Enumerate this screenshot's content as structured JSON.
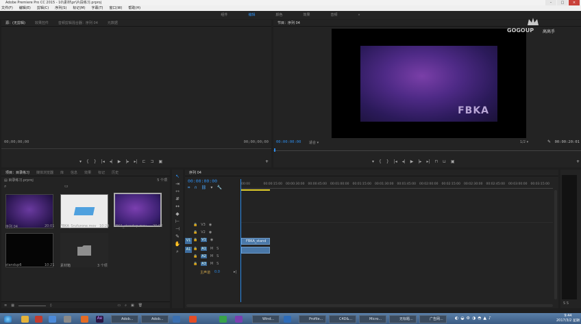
{
  "title_bar": {
    "text": "Adobe Premiere Pro CC 2015 - 10\\素材\\pr\\片段练习.prproj"
  },
  "menu": [
    "文件(F)",
    "编辑(E)",
    "剪辑(C)",
    "序列(S)",
    "标记(M)",
    "字幕(T)",
    "窗口(W)",
    "帮助(H)"
  ],
  "workspaces": {
    "items": [
      "组件",
      "编辑",
      "颜色",
      "效果",
      "音频"
    ],
    "active": 1
  },
  "source_panel": {
    "tabs": [
      "源：(无剪辑)",
      "效果控件",
      "音频剪辑混合器：序列 04",
      "元数据"
    ],
    "timecode_left": "00;00;00;00",
    "timecode_right": "00;00;00;00"
  },
  "program_panel": {
    "tab": "节目：序列 04",
    "timecode": "00:00:00:00",
    "fit": "适合",
    "ratio": "1/2",
    "timecode_end": "00:00:20:01",
    "watermark": "FBKA"
  },
  "logo": {
    "text": "GOGOUP",
    "sub": "高高手"
  },
  "project_panel": {
    "tabs": [
      "项目：目录练习",
      "媒体浏览器",
      "库",
      "信息",
      "效果",
      "标记",
      "历史"
    ],
    "path": "目录练习.prproj",
    "count": "5 个项",
    "items": [
      {
        "name": "序列 04",
        "dur": "20:01"
      },
      {
        "name": "FBKA_Srufurone.mov",
        "dur": "10:24"
      },
      {
        "name": "FBKA_standup.mov",
        "dur": "20:02"
      },
      {
        "name": "standup6",
        "dur": "10:21"
      },
      {
        "name": "素材箱",
        "dur": "3 个项"
      }
    ]
  },
  "timeline": {
    "tab": "序列 04",
    "timecode": "00:00:00:00",
    "ruler": [
      "00:00",
      "00:00:15:00",
      "00:00:30:00",
      "00:00:45:00",
      "00:01:00:00",
      "00:01:15:00",
      "00:01:30:00",
      "00:01:45:00",
      "00:02:00:00",
      "00:02:15:00",
      "00:02:30:00",
      "00:02:45:00",
      "00:03:00:00",
      "00:03:15:00"
    ],
    "tracks": [
      "V3",
      "V2",
      "V1",
      "A1",
      "A2",
      "A3",
      "主声道"
    ],
    "master_val": "0.0",
    "clip_label": "FBKA_stand"
  },
  "taskbar": {
    "buttons": [
      "Adob...",
      "Adob...",
      "Wind...",
      "Profile...",
      "C4D&...",
      "Micro...",
      "无标题...",
      "广告网..."
    ],
    "clock_time": "9:44",
    "clock_date": "2017/3/2 星期四"
  },
  "colors": {
    "accent": "#2d8ceb",
    "panel": "#232323",
    "clip": "#3e6d9e"
  }
}
